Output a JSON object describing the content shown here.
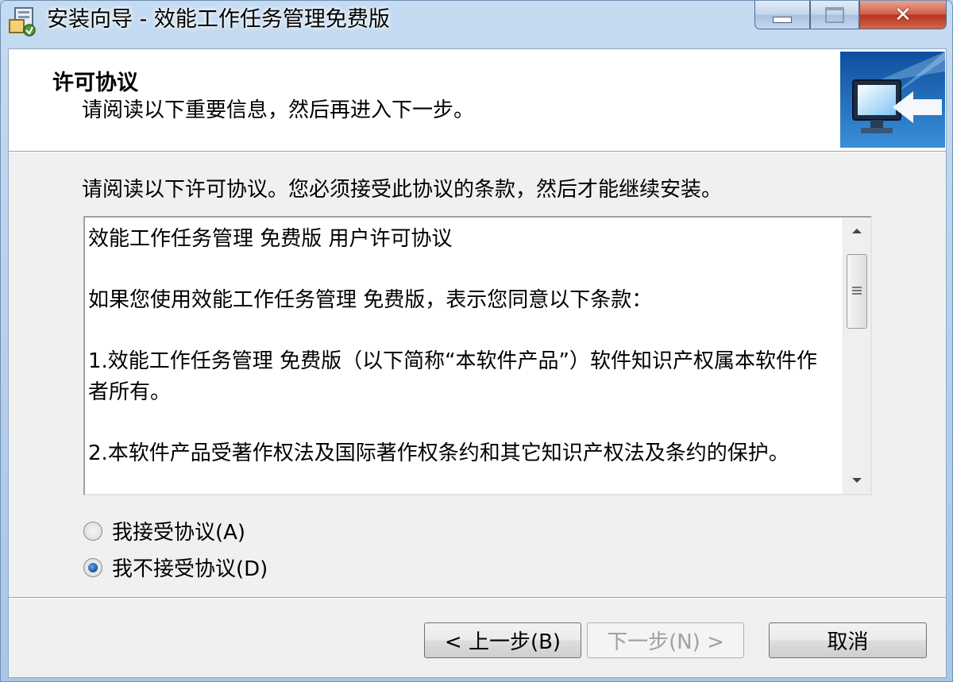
{
  "window": {
    "title": "安装向导 - 效能工作任务管理免费版"
  },
  "header": {
    "title": "许可协议",
    "subtitle": "请阅读以下重要信息，然后再进入下一步。"
  },
  "instruction": "请阅读以下许可协议。您必须接受此协议的条款，然后才能继续安装。",
  "license": {
    "paragraphs": [
      "效能工作任务管理 免费版 用户许可协议",
      "如果您使用效能工作任务管理 免费版，表示您同意以下条款：",
      "1.效能工作任务管理 免费版（以下简称“本软件产品”）软件知识产权属本软件作者所有。",
      "2.本软件产品受著作权法及国际著作权条约和其它知识产权法及条约的保护。"
    ]
  },
  "options": {
    "accept": "我接受协议(A)",
    "decline": "我不接受协议(D)",
    "selected": "decline"
  },
  "buttons": {
    "back": "< 上一步(B)",
    "next": "下一步(N) >",
    "cancel": "取消"
  }
}
